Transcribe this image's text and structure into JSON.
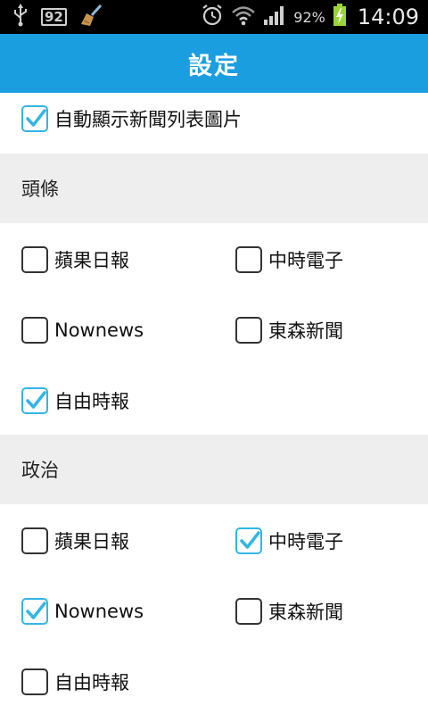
{
  "status_bar": {
    "notification_badge": "92",
    "battery_percent": "92%",
    "time": "14:09",
    "icons": [
      "usb-icon",
      "broom-icon",
      "alarm-icon",
      "wifi-icon",
      "signal-icon",
      "battery-charging-icon"
    ]
  },
  "header": {
    "title": "設定"
  },
  "settings": {
    "auto_image": {
      "label": "自動顯示新聞列表圖片",
      "checked": true
    }
  },
  "sections": [
    {
      "title": "頭條",
      "items": [
        {
          "label": "蘋果日報",
          "checked": false
        },
        {
          "label": "中時電子",
          "checked": false
        },
        {
          "label": "Nownews",
          "checked": false
        },
        {
          "label": "東森新聞",
          "checked": false
        },
        {
          "label": "自由時報",
          "checked": true
        }
      ]
    },
    {
      "title": "政治",
      "items": [
        {
          "label": "蘋果日報",
          "checked": false
        },
        {
          "label": "中時電子",
          "checked": true
        },
        {
          "label": "Nownews",
          "checked": true
        },
        {
          "label": "東森新聞",
          "checked": false
        },
        {
          "label": "自由時報",
          "checked": false
        }
      ]
    }
  ],
  "colors": {
    "action_bar": "#1b9ee0",
    "check_accent": "#33b5e5",
    "section_bg": "#eeeeee"
  }
}
